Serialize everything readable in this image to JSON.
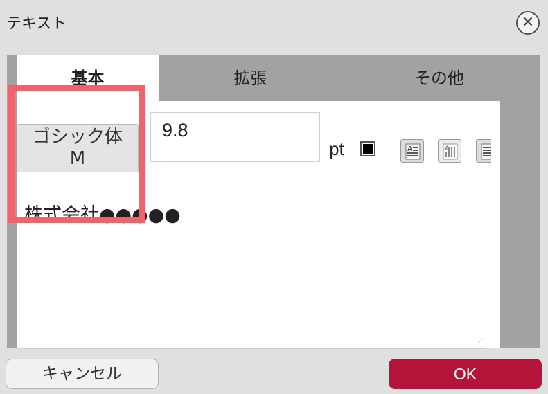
{
  "dialog": {
    "title": "テキスト",
    "close_icon": "close-circle-icon"
  },
  "tabs": [
    {
      "label": "基本",
      "active": true
    },
    {
      "label": "拡張",
      "active": false
    },
    {
      "label": "その他",
      "active": false
    }
  ],
  "font": {
    "button_line1": "ゴシック体",
    "button_line2": "M"
  },
  "size": {
    "value": "9.8",
    "unit": "pt"
  },
  "color": {
    "swatch": "#000000"
  },
  "format_buttons": [
    "horizontal-text-icon",
    "vertical-text-icon",
    "align-text-icon"
  ],
  "text_content": "株式会社●●●●●",
  "buttons": {
    "cancel": "キャンセル",
    "ok": "OK"
  },
  "colors": {
    "ok_bg": "#b5143a",
    "highlight": "#f0636b"
  }
}
